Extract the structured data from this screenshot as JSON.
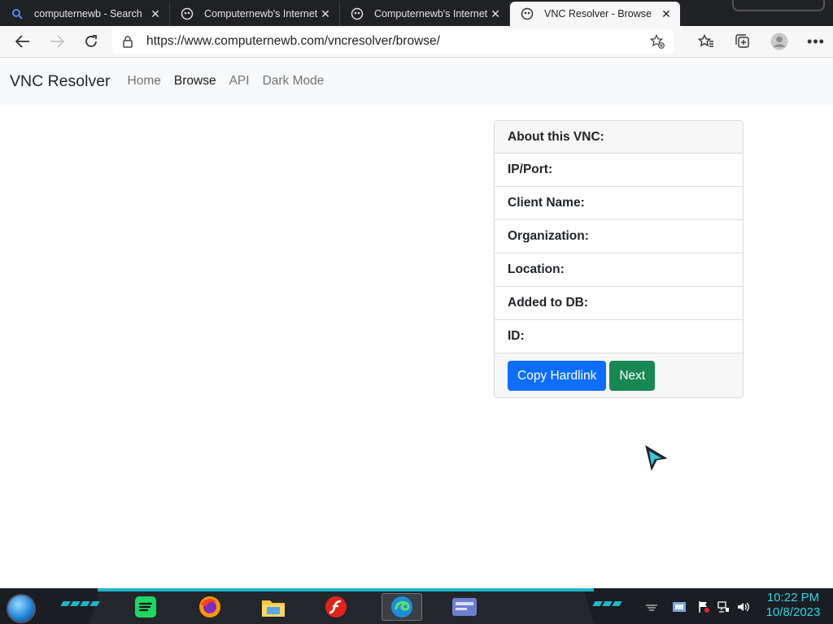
{
  "browser": {
    "tabs": [
      {
        "title": "computernewb - Search",
        "icon": "search-favicon-icon",
        "active": false
      },
      {
        "title": "Computernewb's Internet P",
        "icon": "computernewb-favicon-icon",
        "active": false
      },
      {
        "title": "Computernewb's Internet P",
        "icon": "computernewb-favicon-icon",
        "active": false
      },
      {
        "title": "VNC Resolver - Browse",
        "icon": "computernewb-favicon-icon",
        "active": true
      }
    ],
    "url": "https://www.computernewb.com/vncresolver/browse/"
  },
  "site": {
    "brand": "VNC Resolver",
    "nav": [
      {
        "label": "Home",
        "active": false
      },
      {
        "label": "Browse",
        "active": true
      },
      {
        "label": "API",
        "active": false
      },
      {
        "label": "Dark Mode",
        "active": false
      }
    ]
  },
  "card": {
    "header": "About this VNC:",
    "rows": [
      "IP/Port:",
      "Client Name:",
      "Organization:",
      "Location:",
      "Added to DB:",
      "ID:"
    ],
    "buttons": {
      "copy": "Copy Hardlink",
      "next": "Next"
    }
  },
  "taskbar": {
    "apps": [
      "spotify-icon",
      "firefox-icon",
      "file-explorer-icon",
      "flash-icon",
      "edge-icon",
      "media-app-icon"
    ],
    "time": "10:22 PM",
    "date": "10/8/2023"
  },
  "colors": {
    "primary": "#0d6efd",
    "success": "#198754",
    "accent_cyan": "#1fb6c9"
  }
}
